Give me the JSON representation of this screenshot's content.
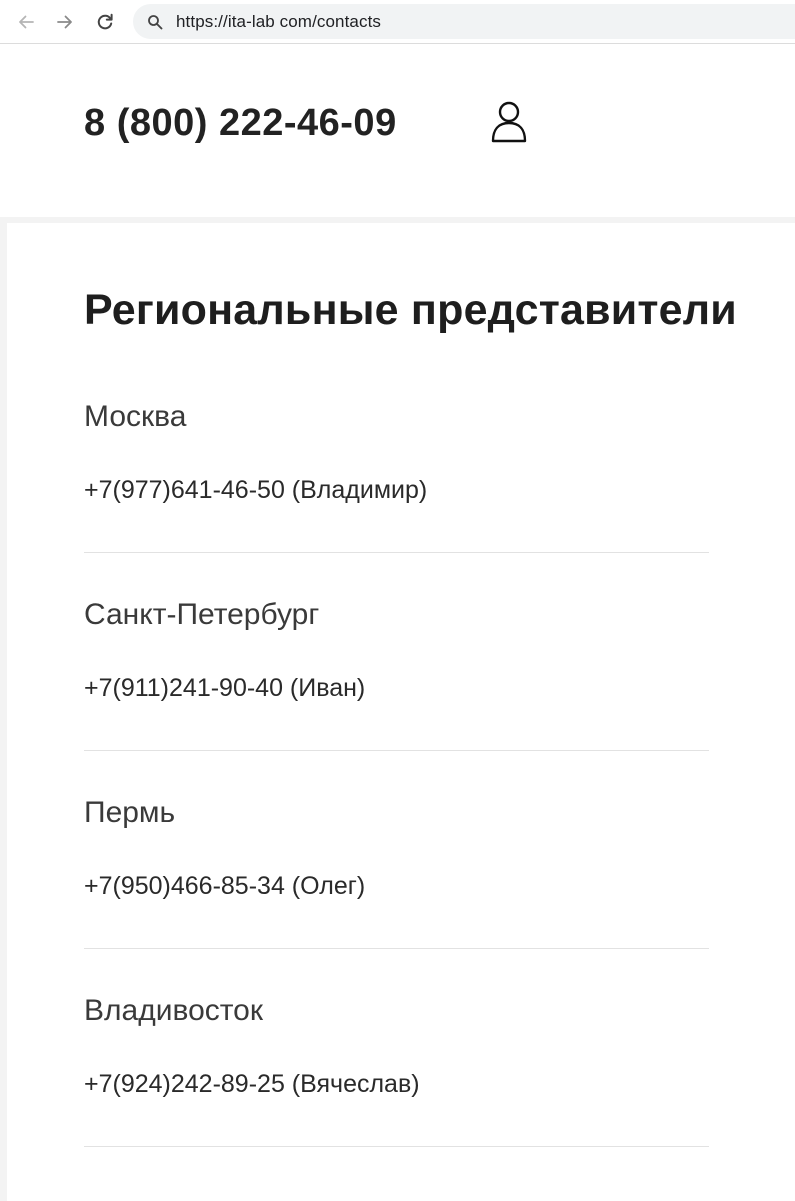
{
  "browser": {
    "url": "https://ita-lab com/contacts",
    "back_icon": "arrow-left-icon",
    "forward_icon": "arrow-right-icon",
    "reload_icon": "reload-icon",
    "search_icon": "search-icon"
  },
  "header": {
    "phone": "8 (800) 222-46-09",
    "account_icon": "user-icon"
  },
  "main": {
    "title": "Региональные представители",
    "regions": [
      {
        "city": "Москва",
        "phone": "+7(977)641-46-50 (Владимир)"
      },
      {
        "city": "Санкт-Петербург",
        "phone": "+7(911)241-90-40 (Иван)"
      },
      {
        "city": "Пермь",
        "phone": "+7(950)466-85-34 (Олег)"
      },
      {
        "city": "Владивосток",
        "phone": "+7(924)242-89-25 (Вячеслав)"
      }
    ]
  },
  "colors": {
    "text_primary": "#222222",
    "page_background": "#ffffff",
    "divider": "#e2e2e2",
    "omnibox_background": "#f1f3f4"
  }
}
